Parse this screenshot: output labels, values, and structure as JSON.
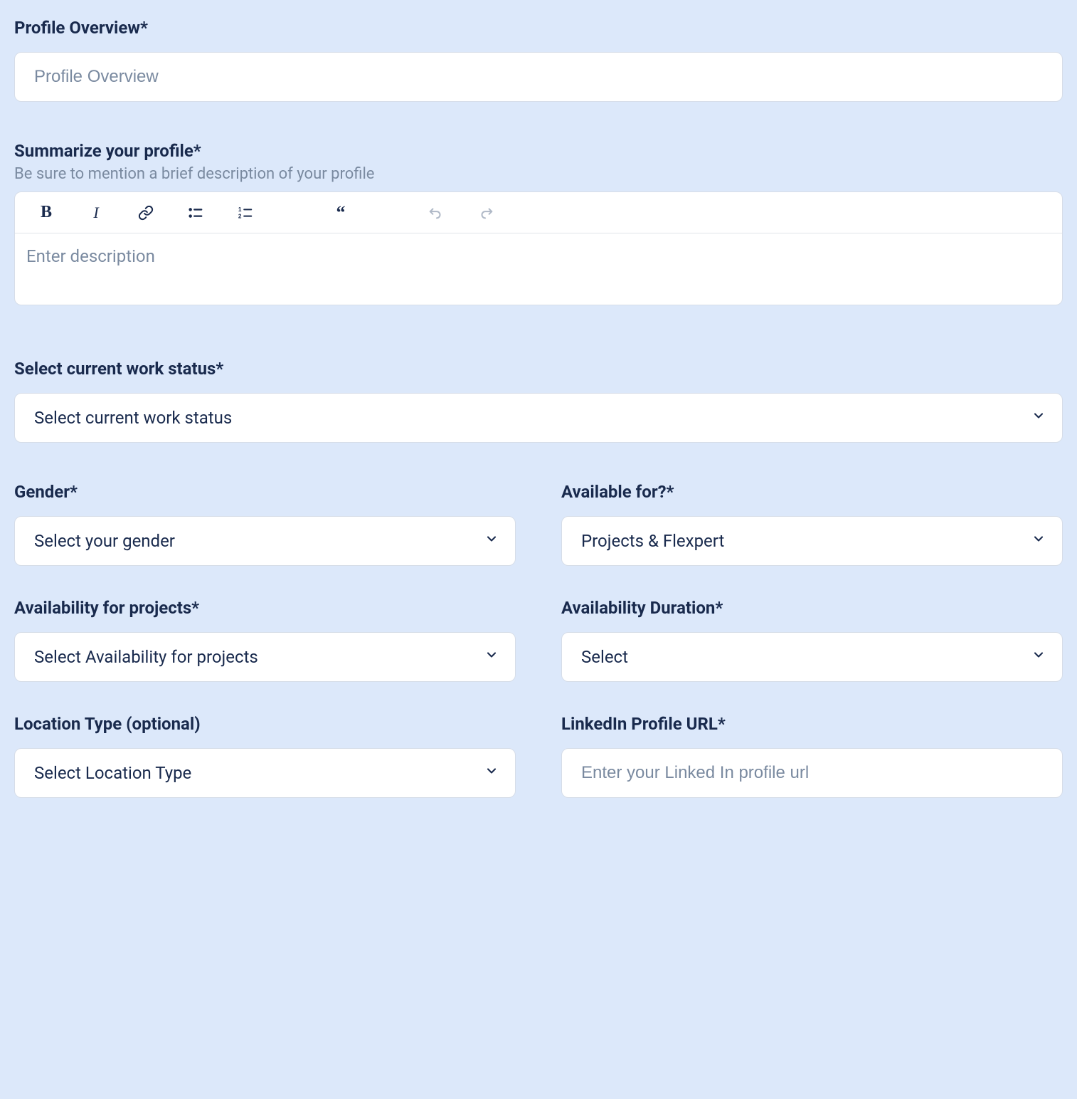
{
  "profileOverview": {
    "label": "Profile Overview*",
    "placeholder": "Profile Overview"
  },
  "summarize": {
    "label": "Summarize your profile*",
    "helper": "Be sure to mention a brief description of your profile",
    "placeholder": "Enter description"
  },
  "workStatus": {
    "label": "Select current work status*",
    "value": "Select current work status"
  },
  "gender": {
    "label": "Gender*",
    "value": "Select your gender"
  },
  "availableFor": {
    "label": "Available for?*",
    "value": "Projects & Flexpert"
  },
  "availabilityProjects": {
    "label": "Availability for projects*",
    "value": "Select Availability for projects"
  },
  "availabilityDuration": {
    "label": "Availability Duration*",
    "value": "Select"
  },
  "locationType": {
    "label": "Location Type (optional)",
    "value": "Select Location Type"
  },
  "linkedin": {
    "label": "LinkedIn Profile URL*",
    "placeholder": "Enter your Linked In profile url"
  }
}
